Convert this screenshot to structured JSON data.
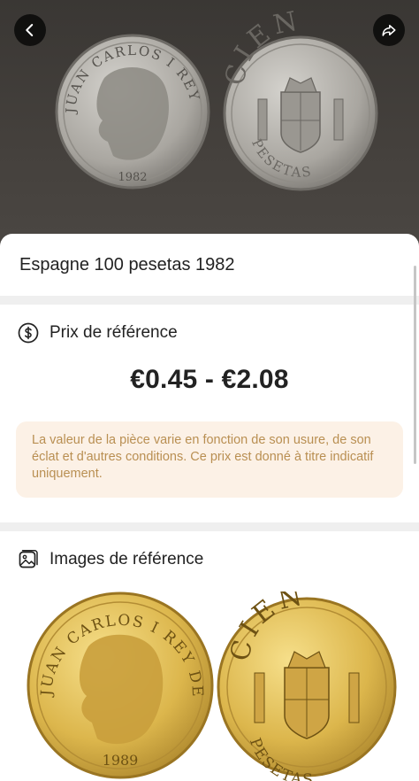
{
  "hero": {
    "coin_obverse": {
      "legend": "JUAN CARLOS I REY DE ESPAÑA",
      "year": "1982"
    },
    "coin_reverse": {
      "top": "CIEN",
      "bottom": "PESETAS"
    }
  },
  "sheet": {
    "title": "Espagne 100 pesetas 1982",
    "price_section": {
      "label": "Prix de référence",
      "range": "€0.45 - €2.08",
      "note": "La valeur de la pièce varie en fonction de son usure, de son éclat et d'autres conditions. Ce prix est donné à titre indicatif uniquement."
    },
    "images_section": {
      "label": "Images de référence",
      "coin_obverse": {
        "legend": "JUAN CARLOS I REY DE ESPAÑA",
        "year": "1989"
      },
      "coin_reverse": {
        "top": "CIEN",
        "bottom": "PESETAS"
      }
    }
  },
  "colors": {
    "note_bg": "#fcf1e6",
    "note_text": "#b98f52",
    "separator": "#efefef",
    "gold_coin": "#d9b24a",
    "silver_coin": "#b9b7b2"
  },
  "icons": [
    "back-arrow-icon",
    "share-icon",
    "dollar-circle-icon",
    "image-gallery-icon"
  ]
}
